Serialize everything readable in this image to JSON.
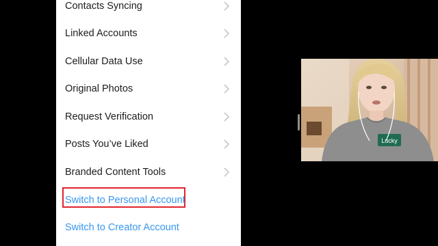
{
  "settings_list": {
    "items": [
      {
        "label": "Contacts Syncing"
      },
      {
        "label": "Linked Accounts"
      },
      {
        "label": "Cellular Data Use"
      },
      {
        "label": "Original Photos"
      },
      {
        "label": "Request Verification"
      },
      {
        "label": "Posts You’ve Liked"
      },
      {
        "label": "Branded Content Tools"
      }
    ],
    "actions": [
      {
        "label": "Switch to Personal Account",
        "highlighted": true
      },
      {
        "label": "Switch to Creator Account",
        "highlighted": false
      }
    ]
  },
  "colors": {
    "link": "#3897f0",
    "highlight": "#e0232a",
    "chevron": "#c7c7cc"
  },
  "icons": {
    "row_chevron": "chevron-right-icon"
  },
  "overlay": {
    "webcam_text": "Lucky"
  }
}
